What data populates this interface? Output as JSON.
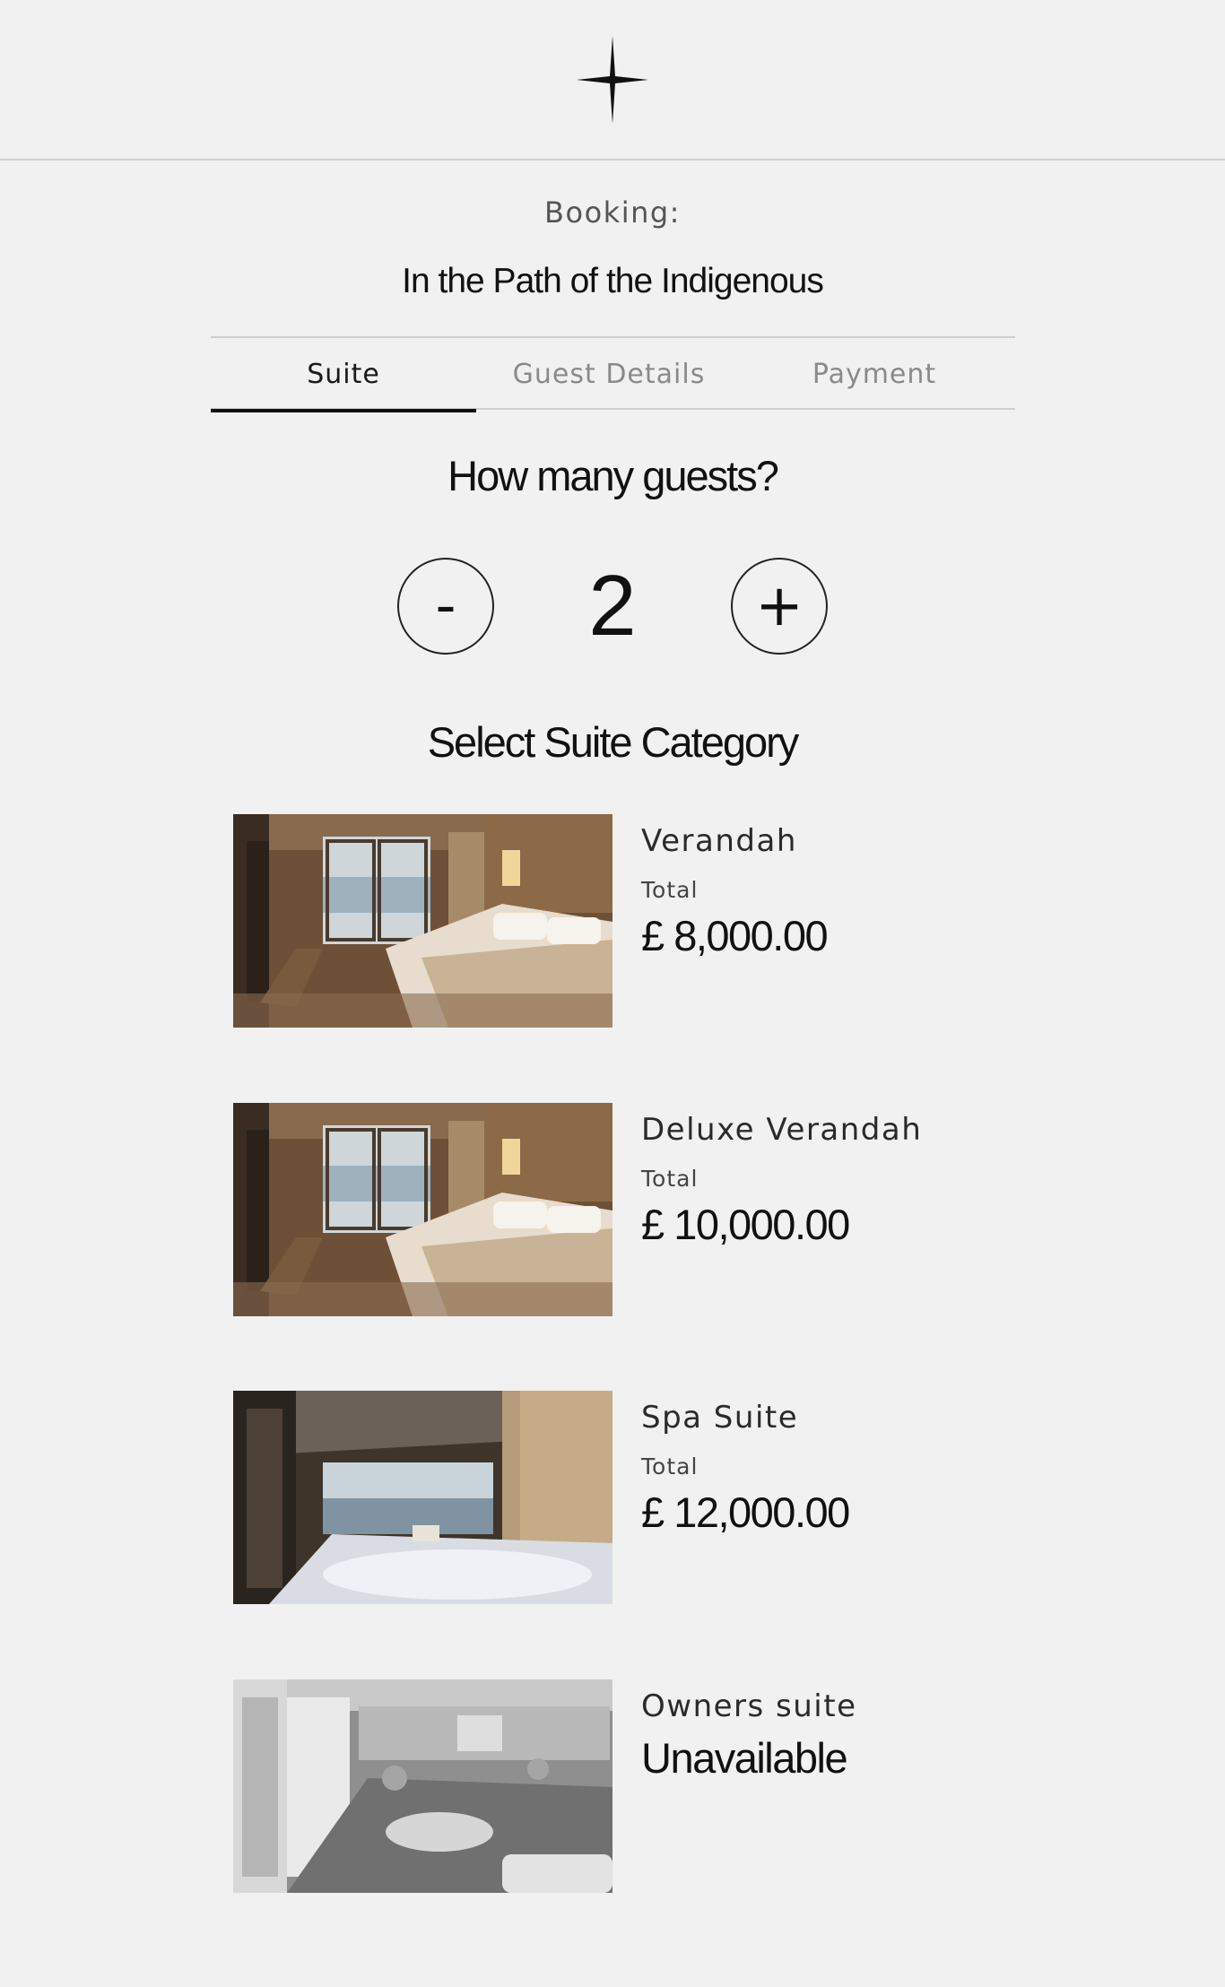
{
  "header": {
    "logo_icon": "four-point-star-icon"
  },
  "booking": {
    "label": "Booking:",
    "trip_title": "In the Path of the Indigenous"
  },
  "tabs": [
    {
      "label": "Suite",
      "active": true
    },
    {
      "label": "Guest Details",
      "active": false
    },
    {
      "label": "Payment",
      "active": false
    }
  ],
  "guests": {
    "question": "How many guests?",
    "decrement_label": "-",
    "increment_label": "+",
    "count": "2"
  },
  "suites": {
    "title": "Select Suite Category",
    "items": [
      {
        "name": "Verandah",
        "total_label": "Total",
        "price": "£ 8,000.00",
        "image": "stateroom-bedroom-photo",
        "available": true
      },
      {
        "name": "Deluxe Verandah",
        "total_label": "Total",
        "price": "£ 10,000.00",
        "image": "stateroom-bedroom-photo",
        "available": true
      },
      {
        "name": "Spa Suite",
        "total_label": "Total",
        "price": "£ 12,000.00",
        "image": "spa-suite-bath-photo",
        "available": true
      },
      {
        "name": "Owners suite",
        "status": "Unavailable",
        "image": "owners-suite-lounge-photo",
        "available": false
      }
    ]
  },
  "colors": {
    "background": "#f2f1f1",
    "text": "#111111",
    "muted": "#8a8a8a",
    "divider": "#cfcfcf"
  }
}
